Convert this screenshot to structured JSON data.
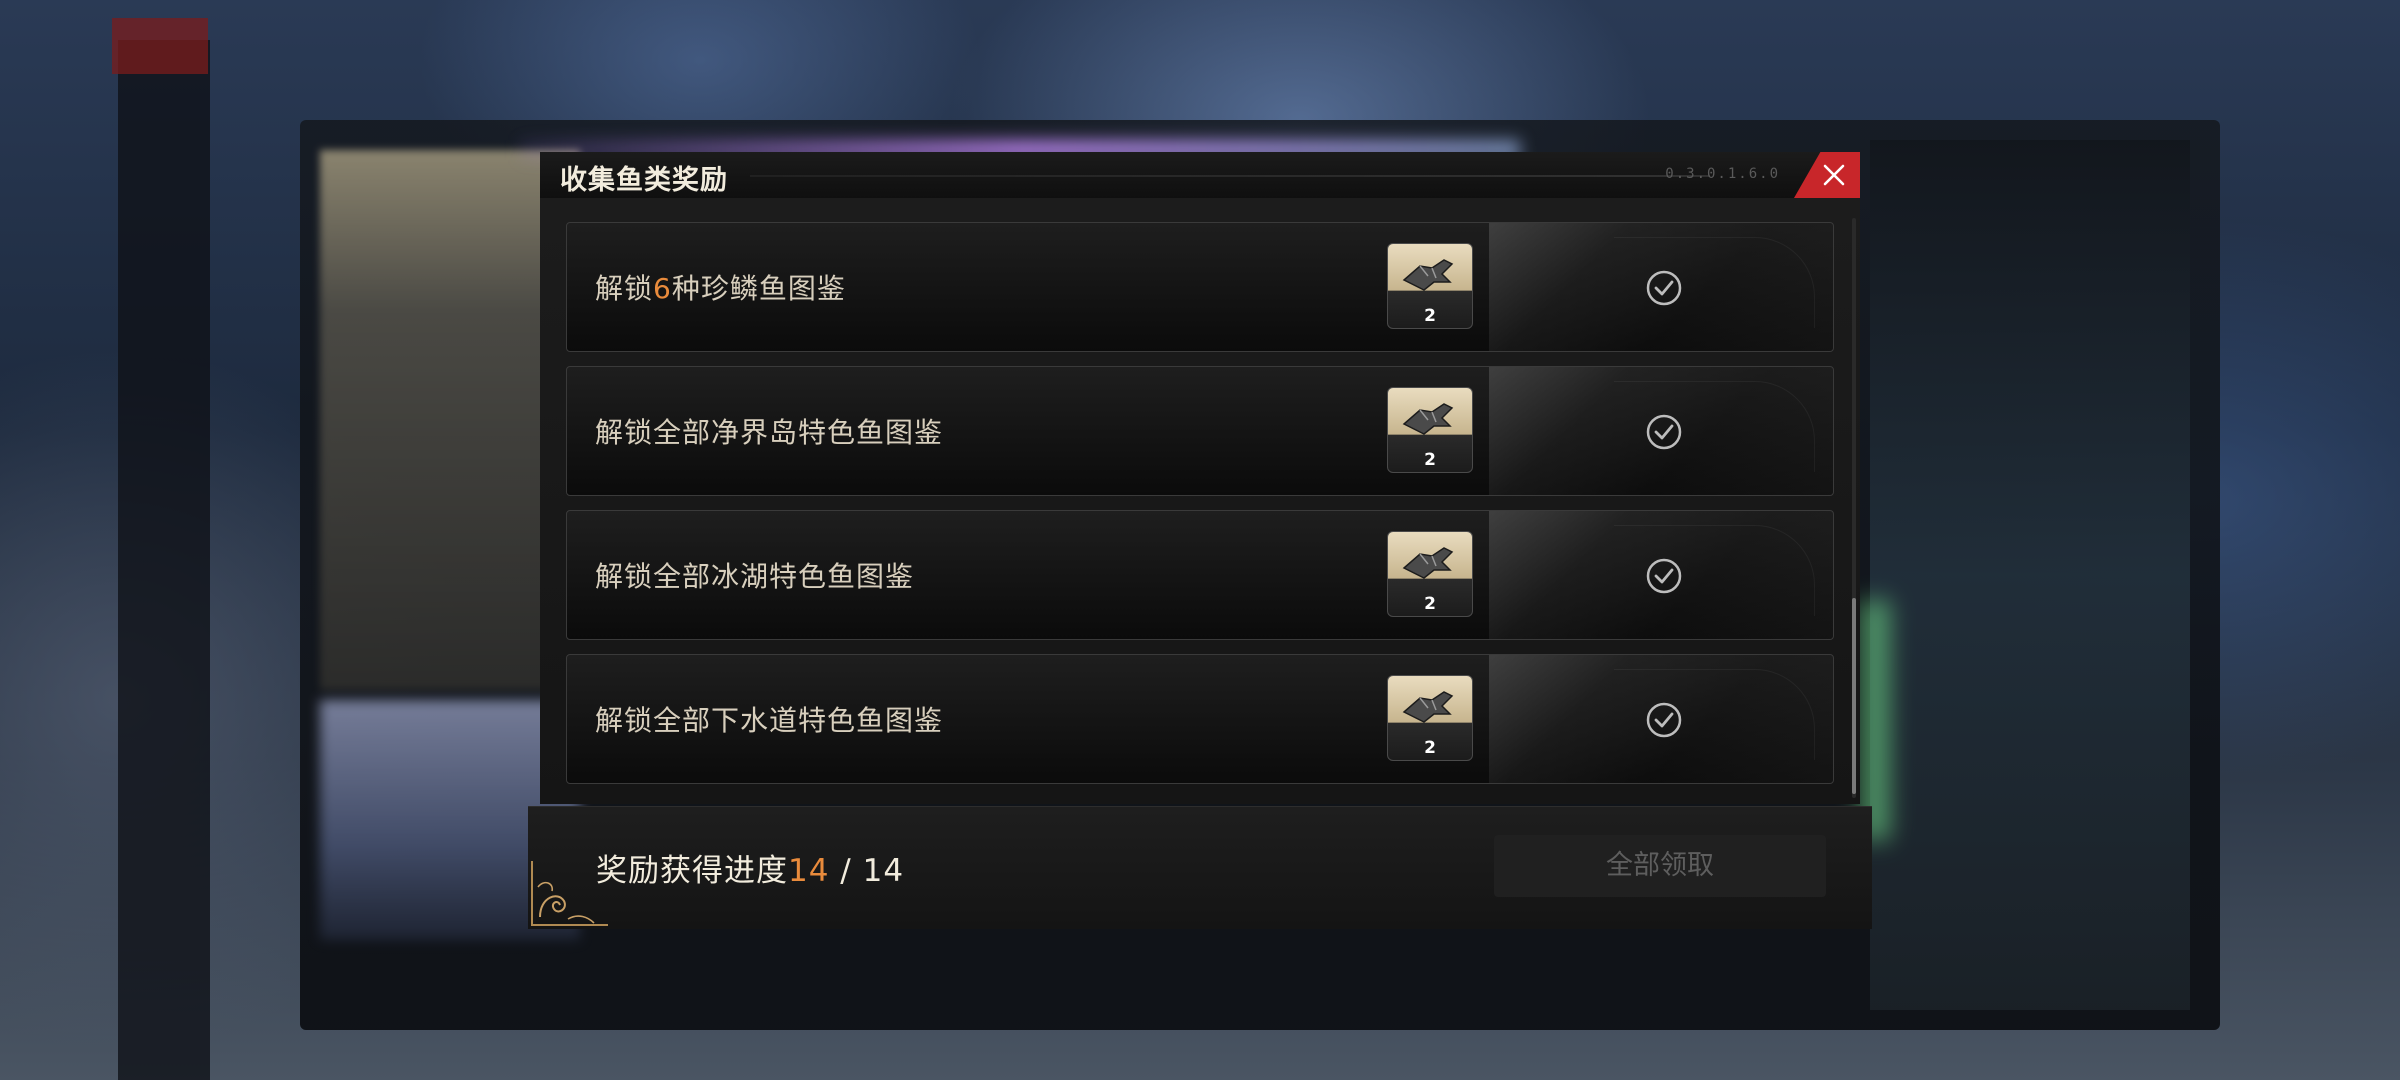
{
  "dialog": {
    "title": "收集鱼类奖励",
    "code_text": "0.3.0.1.6.0"
  },
  "items": [
    {
      "label_prefix": "解锁",
      "label_highlight": "6",
      "label_suffix": "种珍鳞鱼图鉴",
      "reward_count": "2",
      "claimed": true
    },
    {
      "label_prefix": "解锁全部净界岛特色鱼图鉴",
      "label_highlight": "",
      "label_suffix": "",
      "reward_count": "2",
      "claimed": true
    },
    {
      "label_prefix": "解锁全部冰湖特色鱼图鉴",
      "label_highlight": "",
      "label_suffix": "",
      "reward_count": "2",
      "claimed": true
    },
    {
      "label_prefix": "解锁全部下水道特色鱼图鉴",
      "label_highlight": "",
      "label_suffix": "",
      "reward_count": "2",
      "claimed": true
    }
  ],
  "footer": {
    "progress_label": "奖励获得进度",
    "progress_current": "14",
    "progress_sep": " / ",
    "progress_total": "14",
    "claim_all_label": "全部领取"
  },
  "colors": {
    "accent": "#e98b3c",
    "close_red": "#c8262a",
    "text_main": "#d8cfbd"
  }
}
